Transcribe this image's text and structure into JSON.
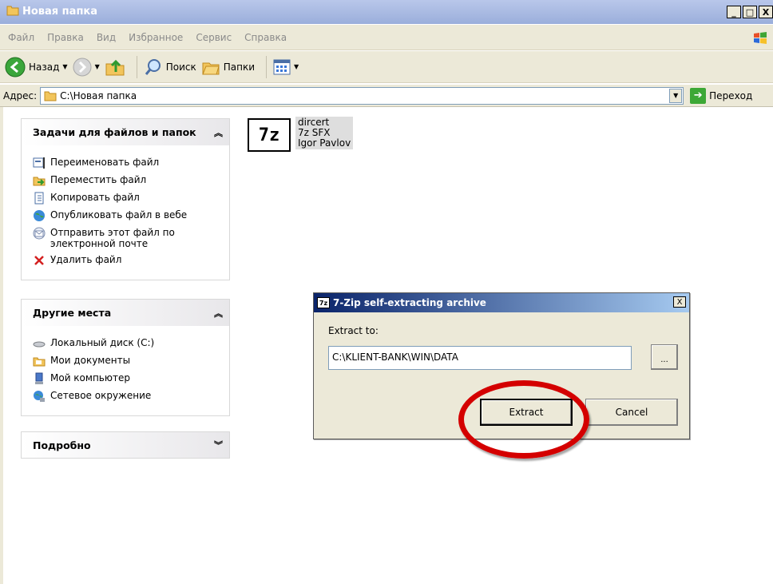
{
  "window": {
    "title": "Новая папка",
    "controls": [
      "_",
      "□",
      "X"
    ]
  },
  "menu": [
    "Файл",
    "Правка",
    "Вид",
    "Избранное",
    "Сервис",
    "Справка"
  ],
  "toolbar": {
    "back_label": "Назад",
    "search_label": "Поиск",
    "folders_label": "Папки"
  },
  "address": {
    "label": "Адрес:",
    "value": "C:\\Новая папка",
    "go_label": "Переход"
  },
  "tasks_panel": {
    "title": "Задачи для файлов и папок",
    "items": [
      "Переименовать файл",
      "Переместить файл",
      "Копировать файл",
      "Опубликовать файл в вебе",
      "Отправить этот файл по электронной почте",
      "Удалить файл"
    ]
  },
  "places_panel": {
    "title": "Другие места",
    "items": [
      "Локальный диск (C:)",
      "Мои документы",
      "Мой компьютер",
      "Сетевое окружение"
    ]
  },
  "details_panel": {
    "title": "Подробно"
  },
  "file": {
    "icon_text": "7z",
    "name": "dircert",
    "type": "7z SFX",
    "author": "Igor Pavlov"
  },
  "dialog": {
    "icon_text": "7z",
    "title": "7-Zip self-extracting archive",
    "extract_to_label": "Extract to:",
    "path": "C:\\KLIENT-BANK\\WIN\\DATA",
    "browse_label": "...",
    "extract_label": "Extract",
    "cancel_label": "Cancel",
    "close_label": "X"
  },
  "colors": {
    "highlight": "#d40000",
    "dialog_title_start": "#0a246a"
  }
}
